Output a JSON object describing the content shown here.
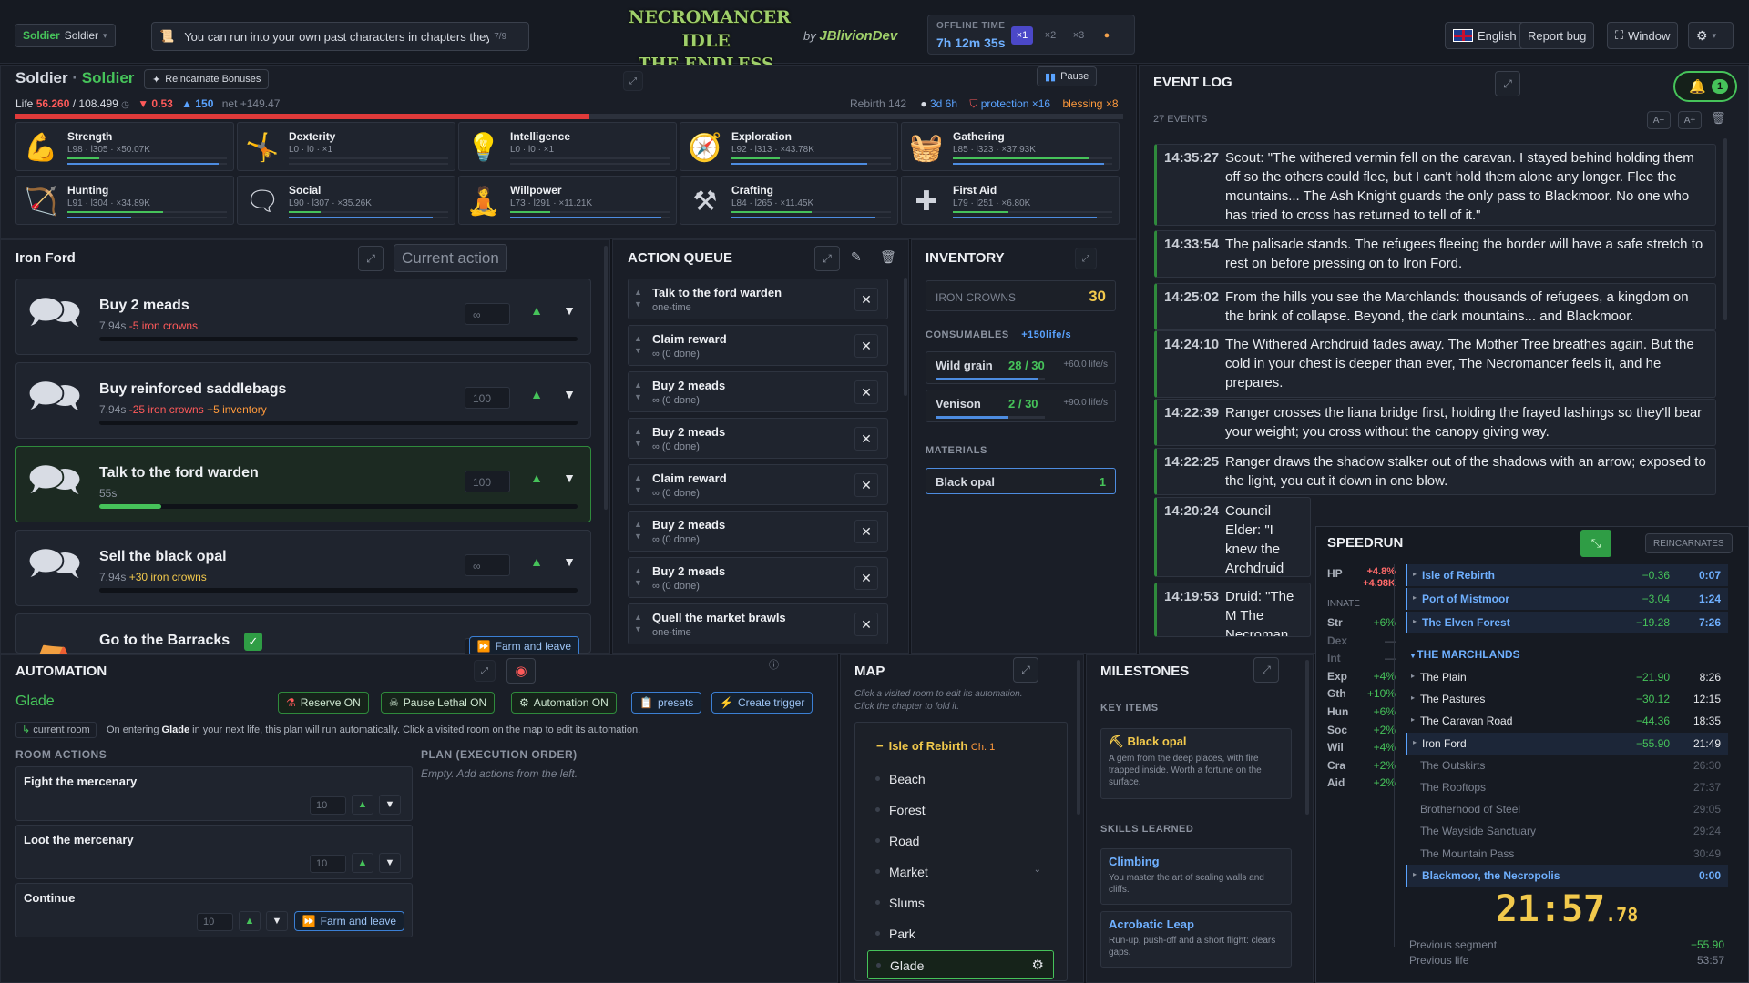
{
  "topbar": {
    "char_name": "Soldier",
    "char_class": "Soldier",
    "ticker": "You can run into your own past characters in chapters they've",
    "ticker_count": "7/9",
    "logo_line1": "NECROMANCER IDLE",
    "logo_line2": "THE ENDLESS DRAIN",
    "by": "by",
    "author": "JBlivionDev",
    "offline_label": "OFFLINE TIME",
    "offline_time": "7h 12m 35s",
    "speeds": [
      "×1",
      "×2",
      "×3"
    ],
    "language": "English",
    "report_bug": "Report bug",
    "window": "Window"
  },
  "character": {
    "name": "Soldier",
    "sep": "·",
    "class": "Soldier",
    "reincarnate": "Reincarnate Bonuses",
    "pause": "Pause",
    "life_label": "Life",
    "life_cur": "56.260",
    "life_max": "/ 108.499",
    "life_drain": "▼ 0.53",
    "life_gain": "▲ 150",
    "life_net": "net +149.47",
    "life_fraction": 0.5185,
    "rebirth": "Rebirth 142",
    "age": "3d 6h",
    "protection": "protection ×16",
    "blessing": "blessing ×8"
  },
  "skills": [
    {
      "name": "Strength",
      "level": "L98 · l305 · ×50.07K",
      "icon": "arm-icon",
      "p1": 0.2,
      "p2": 0.95
    },
    {
      "name": "Dexterity",
      "level": "L0 · l0 · ×1",
      "icon": "acrobat-icon",
      "p1": 0.0,
      "p2": 0.0
    },
    {
      "name": "Intelligence",
      "level": "L0 · l0 · ×1",
      "icon": "bulb-icon",
      "p1": 0.0,
      "p2": 0.0
    },
    {
      "name": "Exploration",
      "level": "L92 · l313 · ×43.78K",
      "icon": "explorer-icon",
      "p1": 0.3,
      "p2": 0.85
    },
    {
      "name": "Gathering",
      "level": "L85 · l323 · ×37.93K",
      "icon": "basket-icon",
      "p1": 0.85,
      "p2": 0.95
    },
    {
      "name": "Hunting",
      "level": "L91 · l304 · ×34.89K",
      "icon": "hunter-icon",
      "p1": 0.6,
      "p2": 0.4
    },
    {
      "name": "Social",
      "level": "L90 · l307 · ×35.26K",
      "icon": "social-icon",
      "p1": 0.2,
      "p2": 0.9
    },
    {
      "name": "Willpower",
      "level": "L73 · l291 · ×11.21K",
      "icon": "meditate-icon",
      "p1": 0.25,
      "p2": 0.95
    },
    {
      "name": "Crafting",
      "level": "L84 · l265 · ×11.45K",
      "icon": "anvil-icon",
      "p1": 0.5,
      "p2": 0.9
    },
    {
      "name": "First Aid",
      "level": "L79 · l251 · ×6.80K",
      "icon": "cross-icon",
      "p1": 0.35,
      "p2": 0.9
    }
  ],
  "location": {
    "title": "Iron Ford",
    "current_action": "Current action"
  },
  "actions": [
    {
      "name": "Buy 2 meads",
      "time": "7.94s",
      "cost": "-5 iron crowns",
      "extra": "",
      "count": "∞",
      "progress": 0
    },
    {
      "name": "Buy reinforced saddlebags",
      "time": "7.94s",
      "cost": "-25 iron crowns",
      "extra": "+5 inventory",
      "count": "100",
      "progress": 0
    },
    {
      "name": "Talk to the ford warden",
      "time": "55s",
      "cost": "",
      "extra": "",
      "count": "100",
      "progress": 0.13
    },
    {
      "name": "Sell the black opal",
      "time": "7.94s",
      "cost": "",
      "extra": "+30 iron crowns",
      "count": "∞",
      "progress": 0
    },
    {
      "name": "Go to the Barracks",
      "time": "",
      "cost": "",
      "extra": "",
      "count": "100",
      "progress": 0,
      "check": "✓",
      "farm": "Farm and leave"
    }
  ],
  "queue": {
    "title": "ACTION QUEUE",
    "items": [
      {
        "name": "Talk to the ford warden",
        "sub": "one-time"
      },
      {
        "name": "Claim reward",
        "sub": "∞ (0 done)"
      },
      {
        "name": "Buy 2 meads",
        "sub": "∞ (0 done)"
      },
      {
        "name": "Buy 2 meads",
        "sub": "∞ (0 done)"
      },
      {
        "name": "Claim reward",
        "sub": "∞ (0 done)"
      },
      {
        "name": "Buy 2 meads",
        "sub": "∞ (0 done)"
      },
      {
        "name": "Buy 2 meads",
        "sub": "∞ (0 done)"
      },
      {
        "name": "Quell the market brawls",
        "sub": "one-time"
      }
    ]
  },
  "inventory": {
    "title": "INVENTORY",
    "currency": "IRON CROWNS",
    "currency_val": "30",
    "consumables": "CONSUMABLES",
    "consumables_rate": "+150life/s",
    "items": [
      {
        "name": "Wild grain",
        "val": "28 / 30",
        "rate": "+60.0 life/s",
        "fill": 0.93
      },
      {
        "name": "Venison",
        "val": "2 / 30",
        "rate": "+90.0 life/s",
        "fill": 0.67
      }
    ],
    "materials": "MATERIALS",
    "material": {
      "name": "Black opal",
      "val": "1"
    }
  },
  "eventlog": {
    "title": "EVENT LOG",
    "count": "27 EVENTS",
    "bell_count": "1",
    "font_minus": "A−",
    "font_plus": "A+",
    "events": [
      {
        "time": "14:35:27",
        "text": "Scout: \"The withered vermin fell on the caravan. I stayed behind holding them off so the others could flee, but I can't hold them alone any longer. Flee the mountains... The Ash Knight guards the only pass to Blackmoor. No one who has tried to cross has returned to tell of it.\""
      },
      {
        "time": "14:33:54",
        "text": "The palisade stands. The refugees fleeing the border will have a safe stretch to rest on before pressing on to Iron Ford."
      },
      {
        "time": "14:25:02",
        "text": "From the hills you see the Marchlands: thousands of refugees, a kingdom on the brink of collapse. Beyond, the dark mountains... and Blackmoor."
      },
      {
        "time": "14:24:10",
        "text": "The Withered Archdruid fades away. The Mother Tree breathes again. But the cold in your chest is deeper than ever, The Necromancer feels it, and he prepares."
      },
      {
        "time": "14:22:39",
        "text": "Ranger crosses the liana bridge first, holding the frayed lashings so they'll bear your weight; you cross without the canopy giving way."
      },
      {
        "time": "14:22:25",
        "text": "Ranger draws the shadow stalker out of the shadows with an arrow; exposed to the light, you cut it down in one blow."
      },
      {
        "time": "14:20:24",
        "text": "Council Elder: \"I knew the Archdruid before the shadow touched him. He was the wisest of u into extension Including the"
      },
      {
        "time": "14:19:53",
        "text": "Druid: \"The M The Necroman can enter to st"
      }
    ]
  },
  "automation": {
    "title": "AUTOMATION",
    "room": "Glade",
    "reserve": "Reserve ON",
    "pause_lethal": "Pause Lethal ON",
    "auto": "Automation ON",
    "presets": "presets",
    "trigger": "Create trigger",
    "current_room": "current room",
    "desc_pre": "On entering ",
    "desc_room": "Glade",
    "desc_post": " in your next life, this plan will run automatically. Click a visited room on the map to edit its automation.",
    "room_actions": "ROOM ACTIONS",
    "plan_title": "PLAN (EXECUTION ORDER)",
    "plan_empty": "Empty. Add actions from the left.",
    "actions": [
      {
        "name": "Fight the mercenary",
        "count": "10"
      },
      {
        "name": "Loot the mercenary",
        "count": "10"
      },
      {
        "name": "Continue",
        "count": "10",
        "farm": "Farm and leave"
      }
    ]
  },
  "map": {
    "title": "MAP",
    "hint1": "Click a visited room to edit its automation.",
    "hint2": "Click the chapter to fold it.",
    "chapter": "Isle of Rebirth",
    "chapter_num": "Ch. 1",
    "rooms": [
      "Beach",
      "Forest",
      "Road",
      "Market",
      "Slums",
      "Park",
      "Glade"
    ]
  },
  "milestones": {
    "title": "MILESTONES",
    "key_items": "KEY ITEMS",
    "item": {
      "name": "Black opal",
      "desc": "A gem from the deep places, with fire trapped inside. Worth a fortune on the surface."
    },
    "skills_learned": "SKILLS LEARNED",
    "skills": [
      {
        "name": "Climbing",
        "desc": "You master the art of scaling walls and cliffs."
      },
      {
        "name": "Acrobatic Leap",
        "desc": "Run-up, push-off and a short flight: clears gaps."
      }
    ]
  },
  "speedrun": {
    "title": "SPEEDRUN",
    "reincarnates": "REINCARNATES",
    "hp_label": "HP",
    "hp1": "+4.8%",
    "hp2": "+4.98K",
    "innate": "INNATE",
    "stats": [
      {
        "k": "Str",
        "v": "+6%"
      },
      {
        "k": "Dex",
        "v": "—"
      },
      {
        "k": "Int",
        "v": "—"
      },
      {
        "k": "Exp",
        "v": "+4%"
      },
      {
        "k": "Gth",
        "v": "+10%"
      },
      {
        "k": "Hun",
        "v": "+6%"
      },
      {
        "k": "Soc",
        "v": "+2%"
      },
      {
        "k": "Wil",
        "v": "+4%"
      },
      {
        "k": "Cra",
        "v": "+2%"
      },
      {
        "k": "Aid",
        "v": "+2%"
      }
    ],
    "chapters1": [
      {
        "n": "Isle of Rebirth",
        "d": "−0.36",
        "t": "0:07"
      },
      {
        "n": "Port of Mistmoor",
        "d": "−3.04",
        "t": "1:24"
      },
      {
        "n": "The Elven Forest",
        "d": "−19.28",
        "t": "7:26"
      }
    ],
    "marchlands": "THE MARCHLANDS",
    "segments": [
      {
        "n": "The Plain",
        "d": "−21.90",
        "t": "8:26",
        "s": "done"
      },
      {
        "n": "The Pastures",
        "d": "−30.12",
        "t": "12:15",
        "s": "done"
      },
      {
        "n": "The Caravan Road",
        "d": "−44.36",
        "t": "18:35",
        "s": "done"
      },
      {
        "n": "Iron Ford",
        "d": "−55.90",
        "t": "21:49",
        "s": "current"
      },
      {
        "n": "The Outskirts",
        "d": "",
        "t": "26:30",
        "s": "future"
      },
      {
        "n": "The Rooftops",
        "d": "",
        "t": "27:37",
        "s": "future"
      },
      {
        "n": "Brotherhood of Steel",
        "d": "",
        "t": "29:05",
        "s": "future"
      },
      {
        "n": "The Wayside Sanctuary",
        "d": "",
        "t": "29:24",
        "s": "future"
      },
      {
        "n": "The Mountain Pass",
        "d": "",
        "t": "30:49",
        "s": "future"
      }
    ],
    "last": {
      "n": "Blackmoor, the Necropolis",
      "d": "",
      "t": "0:00"
    },
    "timer_main": "21:57",
    "timer_frac": ".78",
    "prev_seg_label": "Previous segment",
    "prev_seg": "−55.90",
    "prev_life_label": "Previous life",
    "prev_life": "53:57"
  }
}
